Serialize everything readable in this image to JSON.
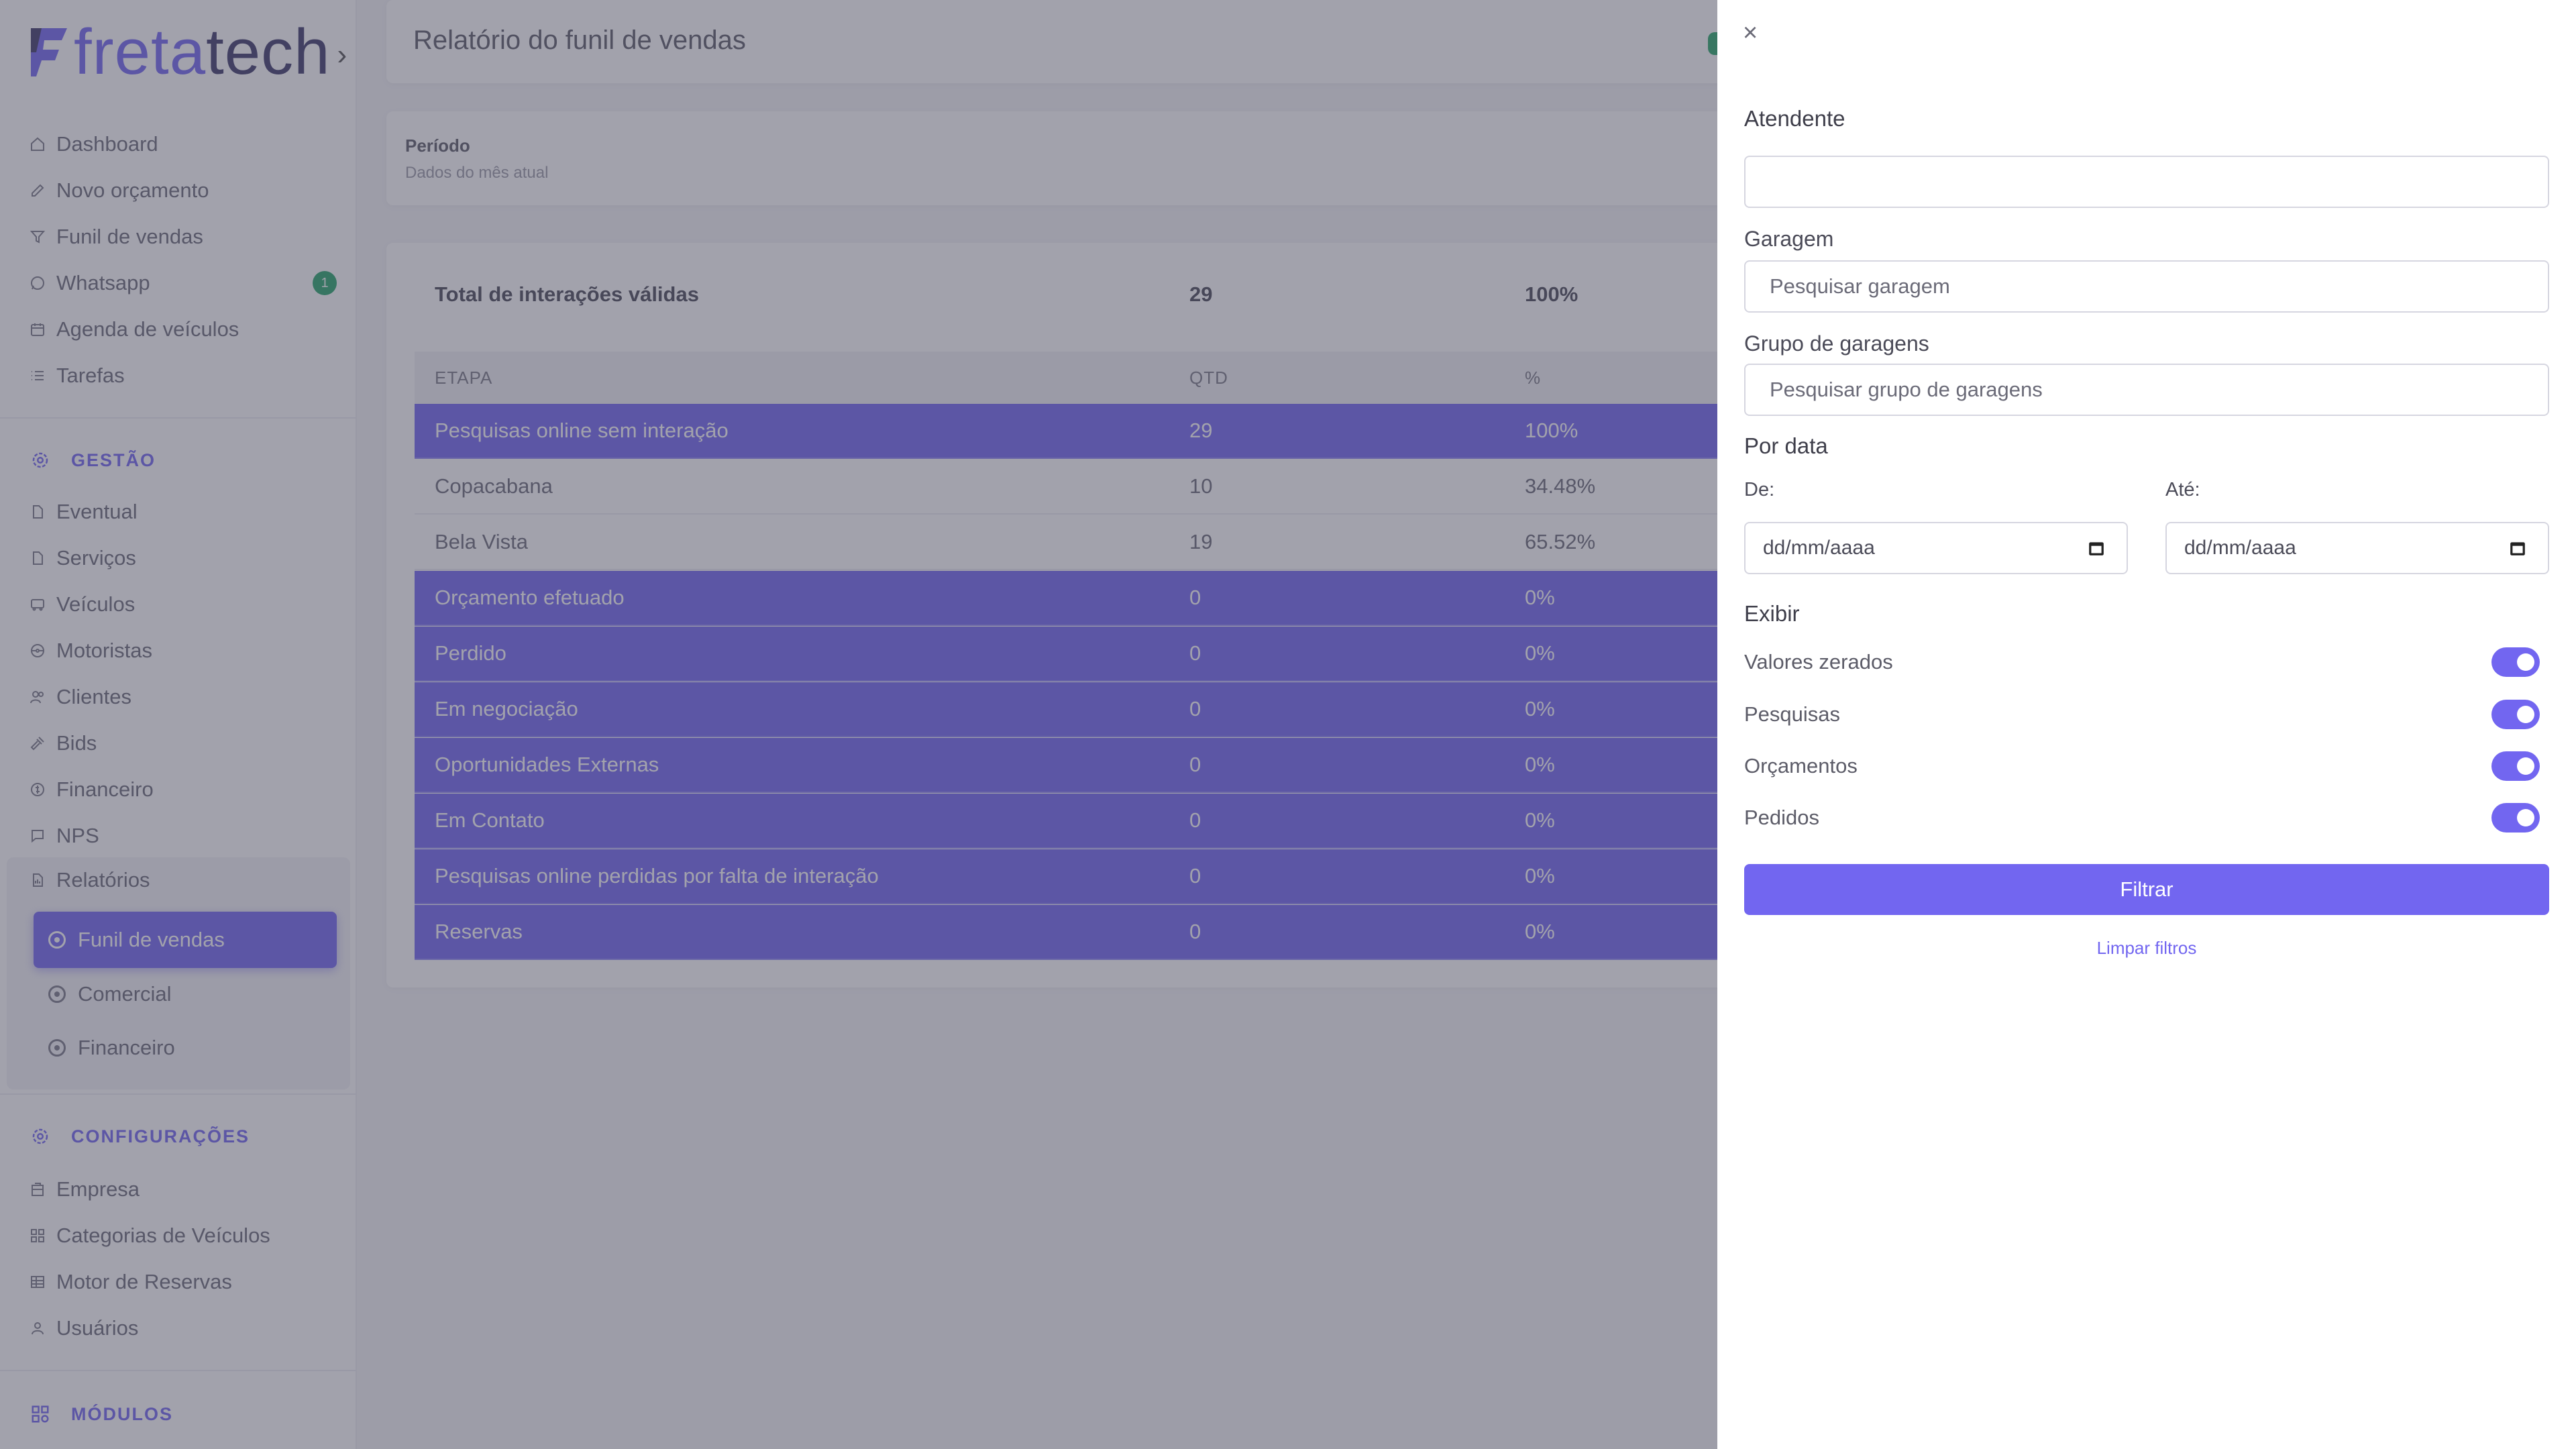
{
  "brand": {
    "name_a": "freta",
    "name_b": "tech",
    "accent": "#7266f0",
    "dark": "#3e3a6a"
  },
  "sidebar": {
    "items": [
      {
        "label": "Dashboard",
        "icon": "home-icon"
      },
      {
        "label": "Novo orçamento",
        "icon": "edit-icon"
      },
      {
        "label": "Funil de vendas",
        "icon": "funnel-icon"
      },
      {
        "label": "Whatsapp",
        "icon": "whatsapp-icon",
        "badge": "1"
      },
      {
        "label": "Agenda de veículos",
        "icon": "calendar-icon"
      },
      {
        "label": "Tarefas",
        "icon": "list-icon"
      }
    ],
    "gestao_title": "GESTÃO",
    "gestao_items": [
      {
        "label": "Eventual",
        "icon": "file-icon"
      },
      {
        "label": "Serviços",
        "icon": "file-icon"
      },
      {
        "label": "Veículos",
        "icon": "bus-icon"
      },
      {
        "label": "Motoristas",
        "icon": "steering-icon"
      },
      {
        "label": "Clientes",
        "icon": "users-icon"
      },
      {
        "label": "Bids",
        "icon": "gavel-icon"
      },
      {
        "label": "Financeiro",
        "icon": "dollar-icon"
      },
      {
        "label": "NPS",
        "icon": "chat-icon"
      },
      {
        "label": "Relatórios",
        "icon": "report-icon"
      }
    ],
    "report_sub": [
      {
        "label": "Funil de vendas",
        "active": true
      },
      {
        "label": "Comercial",
        "active": false
      },
      {
        "label": "Financeiro",
        "active": false
      }
    ],
    "config_title": "CONFIGURAÇÕES",
    "config_items": [
      {
        "label": "Empresa",
        "icon": "building-icon"
      },
      {
        "label": "Categorias de Veículos",
        "icon": "grid-icon"
      },
      {
        "label": "Motor de Reservas",
        "icon": "table-icon"
      },
      {
        "label": "Usuários",
        "icon": "user-icon"
      }
    ],
    "modules_title": "MÓDULOS"
  },
  "main": {
    "title": "Relatório do funil de vendas",
    "period_label": "Período",
    "period_sub": "Dados do mês atual",
    "total": {
      "label": "Total de interações válidas",
      "qty": "29",
      "pct": "100%"
    },
    "headers": {
      "stage": "ETAPA",
      "qty": "QTD",
      "pct": "%"
    },
    "rows": [
      {
        "stage": "Pesquisas online sem interação",
        "qty": "29",
        "pct": "100%",
        "style": "purple"
      },
      {
        "stage": "Copacabana",
        "qty": "10",
        "pct": "34.48%",
        "style": "plain"
      },
      {
        "stage": "Bela Vista",
        "qty": "19",
        "pct": "65.52%",
        "style": "plain"
      },
      {
        "stage": "Orçamento efetuado",
        "qty": "0",
        "pct": "0%",
        "style": "purple"
      },
      {
        "stage": "Perdido",
        "qty": "0",
        "pct": "0%",
        "style": "purple"
      },
      {
        "stage": "Em negociação",
        "qty": "0",
        "pct": "0%",
        "style": "purple"
      },
      {
        "stage": "Oportunidades Externas",
        "qty": "0",
        "pct": "0%",
        "style": "purple"
      },
      {
        "stage": "Em Contato",
        "qty": "0",
        "pct": "0%",
        "style": "purple"
      },
      {
        "stage": "Pesquisas online perdidas por falta de interação",
        "qty": "0",
        "pct": "0%",
        "style": "purple"
      },
      {
        "stage": "Reservas",
        "qty": "0",
        "pct": "0%",
        "style": "purple"
      }
    ]
  },
  "filter": {
    "close_glyph": "×",
    "attendant_label": "Atendente",
    "attendant_value": "",
    "garage_label": "Garagem",
    "garage_placeholder": "Pesquisar garagem",
    "garage_group_label": "Grupo de garagens",
    "garage_group_placeholder": "Pesquisar grupo de garagens",
    "by_date_label": "Por data",
    "from_label": "De:",
    "to_label": "Até:",
    "date_placeholder": "dd/mm/aaaa",
    "show_label": "Exibir",
    "toggles": [
      {
        "label": "Valores zerados",
        "on": true
      },
      {
        "label": "Pesquisas",
        "on": true
      },
      {
        "label": "Orçamentos",
        "on": true
      },
      {
        "label": "Pedidos",
        "on": true
      }
    ],
    "submit_label": "Filtrar",
    "clear_label": "Limpar filtros"
  }
}
